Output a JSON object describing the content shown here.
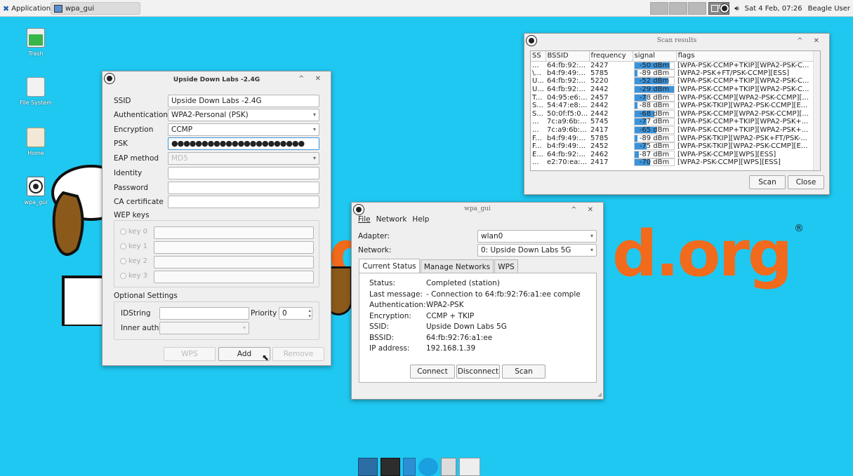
{
  "topbar": {
    "applications_label": "Applications",
    "task_label": "wpa_gui",
    "datetime": "Sat  4 Feb, 07:26",
    "user": "Beagle User"
  },
  "desktop": {
    "icons": [
      {
        "label": "Trash",
        "icon": "trash-icon"
      },
      {
        "label": "File System",
        "icon": "drive-icon"
      },
      {
        "label": "Home",
        "icon": "home-folder-icon"
      },
      {
        "label": "wpa_gui",
        "icon": "wpa-gui-icon"
      }
    ],
    "wallpaper_text": "d.org",
    "wallpaper_text2": "g",
    "registered": "®"
  },
  "network_dialog": {
    "title": "Upside Down Labs -2.4G",
    "ssid_label": "SSID",
    "ssid_value": "Upside Down Labs -2.4G",
    "auth_label": "Authentication",
    "auth_value": "WPA2-Personal (PSK)",
    "enc_label": "Encryption",
    "enc_value": "CCMP",
    "psk_label": "PSK",
    "psk_value": "●●●●●●●●●●●●●●●●●●●●●●",
    "eap_label": "EAP method",
    "eap_value": "MD5",
    "identity_label": "Identity",
    "password_label": "Password",
    "ca_label": "CA certificate",
    "wep_label": "WEP keys",
    "wep_keys": [
      "key 0",
      "key 1",
      "key 2",
      "key 3"
    ],
    "optional_label": "Optional Settings",
    "idstring_label": "IDString",
    "priority_label": "Priority",
    "priority_value": "0",
    "inner_auth_label": "Inner auth",
    "wps_button": "WPS",
    "add_button": "Add",
    "remove_button": "Remove"
  },
  "scan_window": {
    "title": "Scan results",
    "columns": [
      "SS",
      "BSSID",
      "frequency",
      "signal",
      "flags"
    ],
    "rows": [
      {
        "ssid": "...",
        "bssid": "64:fb:92:...",
        "freq": "2427",
        "signal": "-50 dBm",
        "level": 0.9,
        "flags": "[WPA-PSK-CCMP+TKIP][WPA2-PSK-C..."
      },
      {
        "ssid": "\\...",
        "bssid": "b4:f9:49:...",
        "freq": "5785",
        "signal": "-89 dBm",
        "level": 0.08,
        "flags": "[WPA2-PSK+FT/PSK-CCMP][ESS]"
      },
      {
        "ssid": "U...",
        "bssid": "64:fb:92:...",
        "freq": "5220",
        "signal": "-52 dBm",
        "level": 0.85,
        "flags": "[WPA-PSK-CCMP+TKIP][WPA2-PSK-C..."
      },
      {
        "ssid": "U...",
        "bssid": "64:fb:92:...",
        "freq": "2442",
        "signal": "-29 dBm",
        "level": 1.0,
        "flags": "[WPA-PSK-CCMP+TKIP][WPA2-PSK-C..."
      },
      {
        "ssid": "T...",
        "bssid": "04:95:e6:...",
        "freq": "2457",
        "signal": "-78 dBm",
        "level": 0.3,
        "flags": "[WPA-PSK-CCMP][WPA2-PSK-CCMP][..."
      },
      {
        "ssid": "S...",
        "bssid": "54:47:e8:...",
        "freq": "2442",
        "signal": "-88 dBm",
        "level": 0.08,
        "flags": "[WPA-PSK-TKIP][WPA2-PSK-CCMP][E..."
      },
      {
        "ssid": "S...",
        "bssid": "50:0f:f5:0...",
        "freq": "2442",
        "signal": "-68 dBm",
        "level": 0.5,
        "flags": "[WPA-PSK-CCMP][WPA2-PSK-CCMP][..."
      },
      {
        "ssid": "...",
        "bssid": "7c:a9:6b:...",
        "freq": "5745",
        "signal": "-77 dBm",
        "level": 0.3,
        "flags": "[WPA-PSK-CCMP+TKIP][WPA2-PSK+..."
      },
      {
        "ssid": "...",
        "bssid": "7c:a9:6b:...",
        "freq": "2417",
        "signal": "-65 dBm",
        "level": 0.55,
        "flags": "[WPA-PSK-CCMP+TKIP][WPA2-PSK+..."
      },
      {
        "ssid": "F...",
        "bssid": "b4:f9:49:...",
        "freq": "5785",
        "signal": "-89 dBm",
        "level": 0.08,
        "flags": "[WPA-PSK-TKIP][WPA2-PSK+FT/PSK-..."
      },
      {
        "ssid": "F...",
        "bssid": "b4:f9:49:...",
        "freq": "2452",
        "signal": "-75 dBm",
        "level": 0.3,
        "flags": "[WPA-PSK-TKIP][WPA2-PSK-CCMP][E..."
      },
      {
        "ssid": "E...",
        "bssid": "64:fb:92:...",
        "freq": "2462",
        "signal": "-87 dBm",
        "level": 0.1,
        "flags": "[WPA-PSK-CCMP][WPS][ESS]"
      },
      {
        "ssid": "...",
        "bssid": "e2:70:ea:...",
        "freq": "2417",
        "signal": "-70 dBm",
        "level": 0.4,
        "flags": "[WPA2-PSK-CCMP][WPS][ESS]"
      }
    ],
    "scan_button": "Scan",
    "close_button": "Close"
  },
  "wpa_gui": {
    "title": "wpa_gui",
    "menu": [
      "File",
      "Network",
      "Help"
    ],
    "adapter_label": "Adapter:",
    "adapter_value": "wlan0",
    "network_label": "Network:",
    "network_value": "0: Upside Down Labs 5G",
    "tabs": [
      "Current Status",
      "Manage Networks",
      "WPS"
    ],
    "status": [
      {
        "k": "Status:",
        "v": "Completed (station)"
      },
      {
        "k": "Last message:",
        "v": "- Connection to 64:fb:92:76:a1:ee comple"
      },
      {
        "k": "Authentication:",
        "v": "WPA2-PSK"
      },
      {
        "k": "Encryption:",
        "v": "CCMP + TKIP"
      },
      {
        "k": "SSID:",
        "v": "Upside Down Labs 5G"
      },
      {
        "k": "BSSID:",
        "v": "64:fb:92:76:a1:ee"
      },
      {
        "k": "IP address:",
        "v": "192.168.1.39"
      }
    ],
    "connect_button": "Connect",
    "disconnect_button": "Disconnect",
    "scan_button": "Scan"
  },
  "colors": {
    "desktop": "#1fc8f1",
    "signal_fill": "#3a94dc",
    "wallpaper_text": "#f26a1b"
  }
}
